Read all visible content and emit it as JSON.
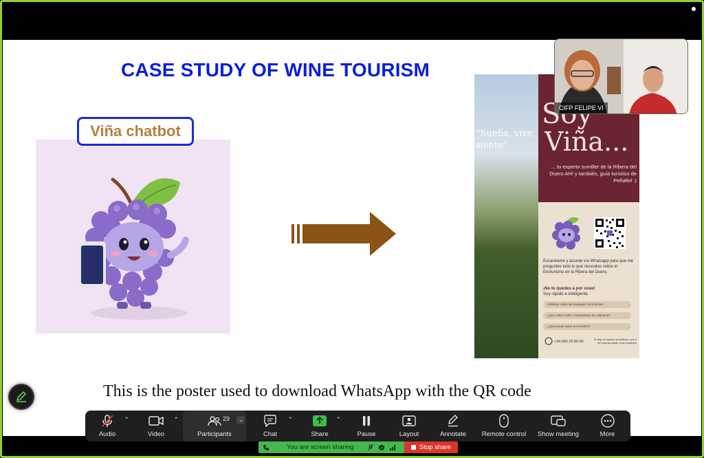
{
  "slide": {
    "title": "CASE STUDY OF WINE TOURISM",
    "chatbot_label": "Viña chatbot",
    "caption": "This is the poster used to download WhatsApp with the QR code"
  },
  "poster": {
    "quote": "“Sueña, vive, siente”",
    "soy": "Soy",
    "vina": "Viña...",
    "tagline": "... tu experto sumiller de la Ribera del Duero AH! y también, guía turístico de Peñafiel :)",
    "scan_text": "Escanéame y accede vía Whatsapp para que me preguntes todo lo que necesites sobre el Enoturismo en la Ribera del Duero.",
    "cta": "¡No te quedes a por uvas!",
    "cta_sub": "Soy rápido e inteligente.",
    "chips": [
      "Háblame sobre las Bodegas Carramimbre",
      "¿Qué sabes sobre el Monasterio de Valbuena?",
      "¿Qué puedo hacer en Peñafiel?"
    ],
    "phone": "+34 692 25 60 82",
    "footer": "Te dejo mi número de teléfono, por si me quieres añadir a tus contactos"
  },
  "video_tile": {
    "name": "CIFP FELIPE VI"
  },
  "toolbar": {
    "audio": "Audio",
    "video": "Video",
    "participants": "Participants",
    "participant_count": "29",
    "chat": "Chat",
    "share": "Share",
    "pause": "Pause",
    "layout": "Layout",
    "annotate": "Annotate",
    "remote_control": "Remote control",
    "show_meeting": "Show meeting",
    "more": "More"
  },
  "share_status": {
    "message": "You are screen sharing",
    "stop_label": "Stop share"
  },
  "colors": {
    "title_blue": "#0a1fdc",
    "label_gold": "#b5813f",
    "arrow_brown": "#8b5316",
    "poster_maroon": "#6a2432",
    "share_green": "#44b84e",
    "stop_red": "#d9362b",
    "frame_green": "#8fce3a"
  }
}
